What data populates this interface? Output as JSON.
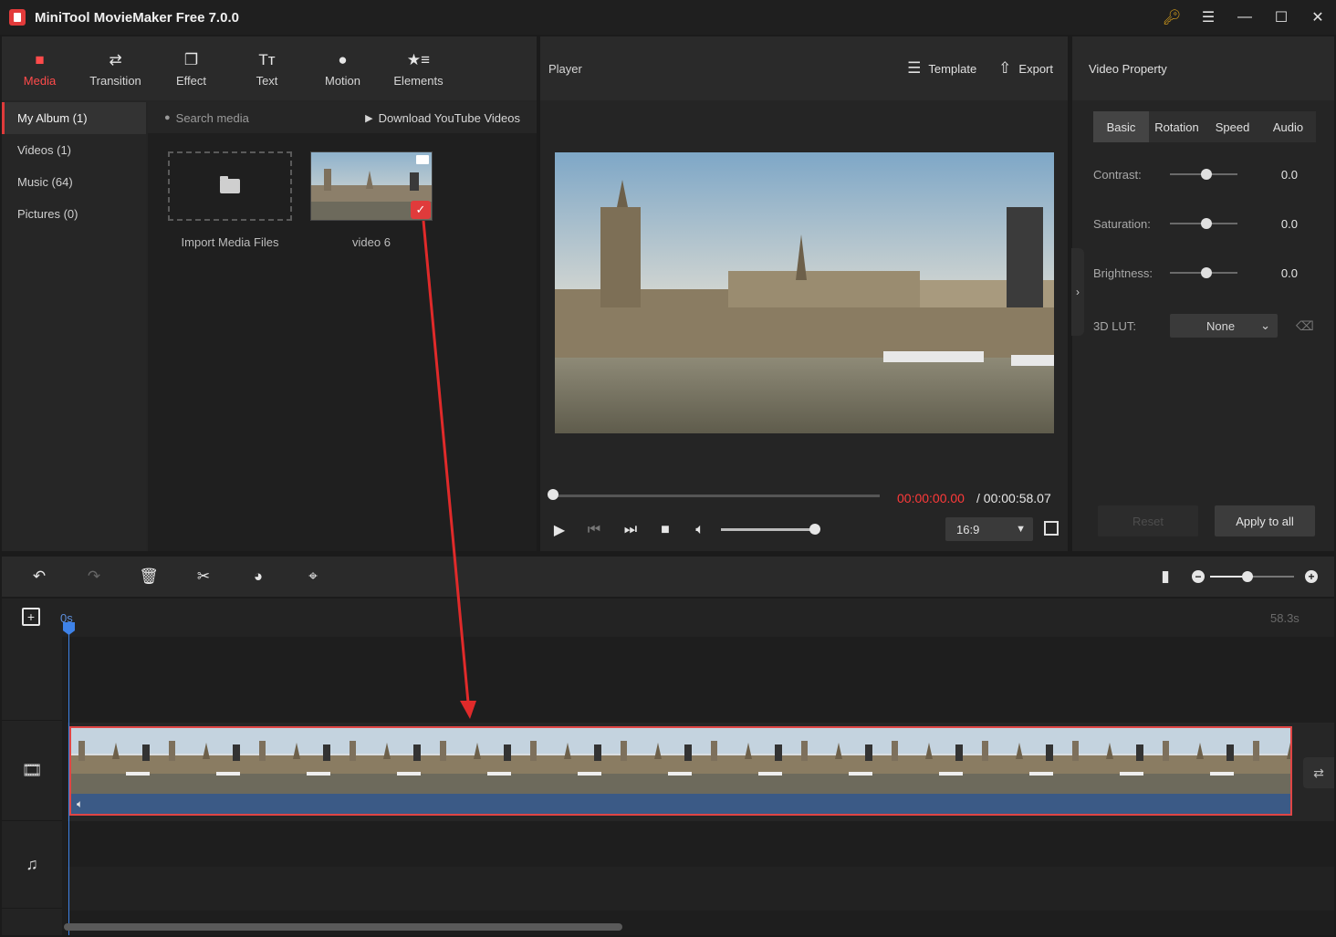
{
  "app": {
    "title": "MiniTool MovieMaker Free 7.0.0"
  },
  "media_tabs": [
    {
      "label": "Media",
      "icon": "folder-icon",
      "active": true
    },
    {
      "label": "Transition",
      "icon": "swap-arrows-icon",
      "active": false
    },
    {
      "label": "Effect",
      "icon": "layers-icon",
      "active": false
    },
    {
      "label": "Text",
      "icon": "text-icon",
      "active": false
    },
    {
      "label": "Motion",
      "icon": "motion-icon",
      "active": false
    },
    {
      "label": "Elements",
      "icon": "elements-icon",
      "active": false
    }
  ],
  "album": [
    {
      "label": "My Album (1)",
      "active": true
    },
    {
      "label": "Videos (1)",
      "active": false
    },
    {
      "label": "Music (64)",
      "active": false
    },
    {
      "label": "Pictures (0)",
      "active": false
    }
  ],
  "media": {
    "search_placeholder": "Search media",
    "youtube_label": "Download YouTube Videos",
    "import_label": "Import Media Files",
    "video_label": "video 6"
  },
  "player": {
    "title": "Player",
    "template_label": "Template",
    "export_label": "Export",
    "time_current": "00:00:00.00",
    "time_total": "/ 00:00:58.07",
    "aspect_ratio": "16:9",
    "progress": 0,
    "volume": 1.0
  },
  "property": {
    "title": "Video Property",
    "tabs": [
      "Basic",
      "Rotation",
      "Speed",
      "Audio"
    ],
    "contrast_label": "Contrast:",
    "contrast_value": "0.0",
    "saturation_label": "Saturation:",
    "saturation_value": "0.0",
    "brightness_label": "Brightness:",
    "brightness_value": "0.0",
    "lut_label": "3D LUT:",
    "lut_value": "None",
    "reset_label": "Reset",
    "apply_label": "Apply to all"
  },
  "timeline": {
    "ruler_start": "0s",
    "ruler_end": "58.3s",
    "zoom_level": 0.45
  },
  "colors": {
    "accent_red": "#ff4b4b",
    "playhead_blue": "#3e82e8",
    "clip_border": "#e04545",
    "time_red": "#ff3a3a"
  }
}
